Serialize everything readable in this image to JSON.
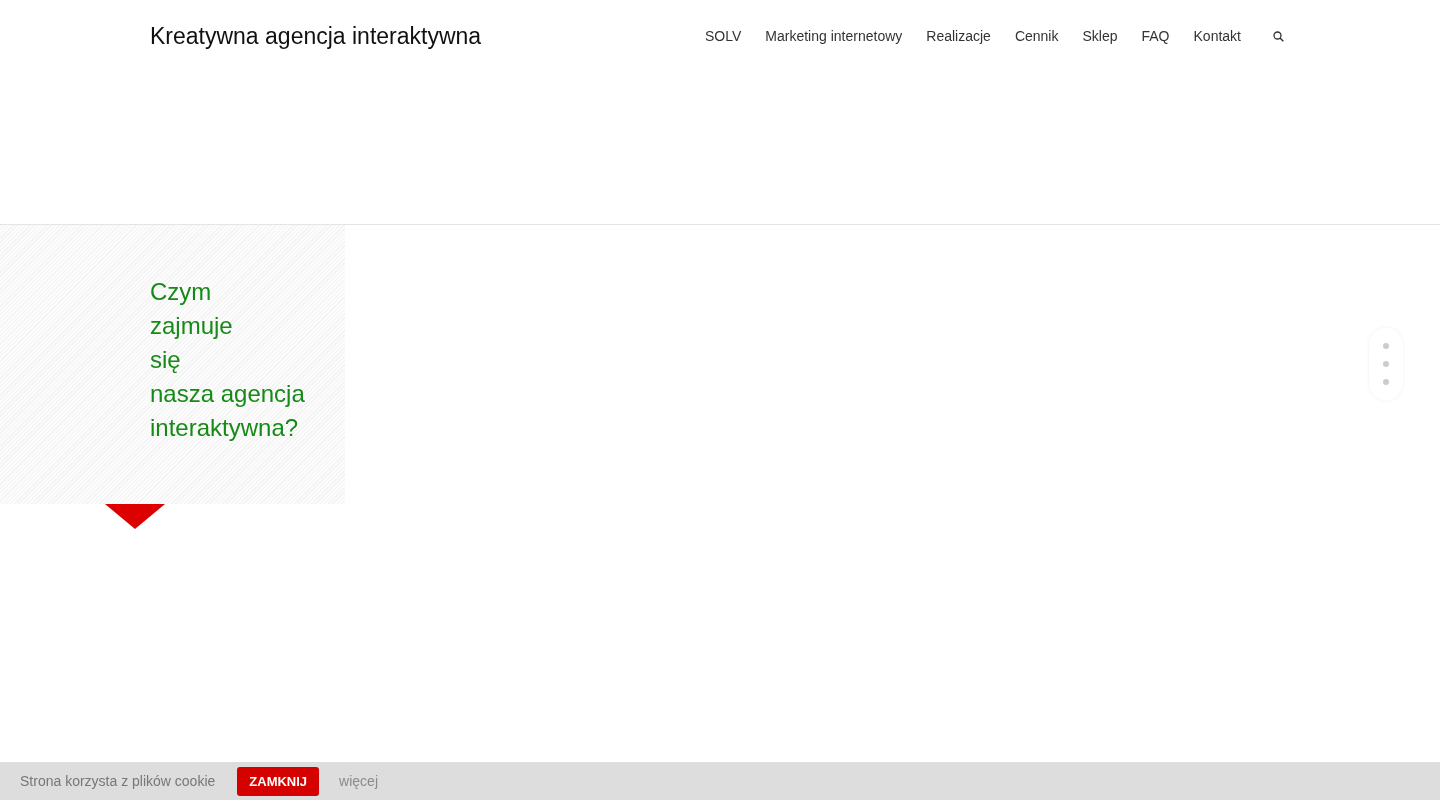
{
  "header": {
    "logo": "Kreatywna agencja interaktywna",
    "nav": [
      {
        "label": "SOLV"
      },
      {
        "label": "Marketing internetowy"
      },
      {
        "label": "Realizacje"
      },
      {
        "label": "Cennik"
      },
      {
        "label": "Sklep"
      },
      {
        "label": "FAQ"
      },
      {
        "label": "Kontakt"
      }
    ]
  },
  "section": {
    "heading_lines": [
      "Czym",
      "zajmuje",
      "się",
      "nasza agencja",
      "interaktywna?"
    ]
  },
  "cookie_bar": {
    "text": "Strona korzysta z plików cookie",
    "close_button": "ZAMKNIJ",
    "more_link": "więcej"
  }
}
